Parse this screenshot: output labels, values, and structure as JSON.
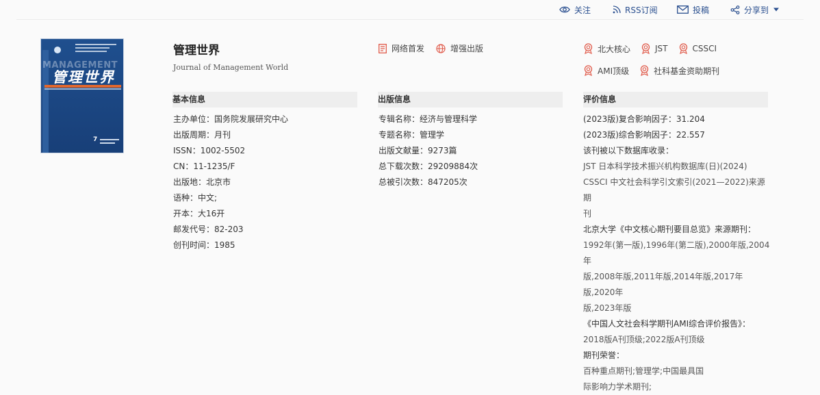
{
  "toolbar": {
    "follow": "关注",
    "rss": "RSS订阅",
    "submit": "投稿",
    "share": "分享到"
  },
  "cover": {
    "title": "管理世界",
    "english_band": "MANAGEMENT",
    "issue": "7"
  },
  "journal": {
    "title": "管理世界",
    "english_title": "Journal of Management World"
  },
  "publish_modes": [
    "网络首发",
    "增强出版"
  ],
  "badges": {
    "row1": [
      "北大核心",
      "JST",
      "CSSCI"
    ],
    "row2": [
      "AMI顶级",
      "社科基金资助期刊"
    ]
  },
  "basic_info": {
    "heading": "基本信息",
    "rows": [
      "主办单位：国务院发展研究中心",
      "出版周期：月刊",
      "ISSN：1002-5502",
      "CN：11-1235/F",
      "出版地：北京市",
      "语种：中文;",
      "开本：大16开",
      "邮发代号：82-203",
      "创刊时间：1985"
    ]
  },
  "publication_info": {
    "heading": "出版信息",
    "rows": [
      "专辑名称：经济与管理科学",
      "专题名称：管理学",
      "出版文献量：9273篇",
      "总下载次数：29209884次",
      "总被引次数：847205次"
    ]
  },
  "evaluation_info": {
    "heading": "评价信息",
    "lines": [
      "(2023版)复合影响因子：31.204",
      "(2023版)综合影响因子：22.557",
      "该刊被以下数据库收录：",
      "JST 日本科学技术振兴机构数据库(日)(2024)",
      "CSSCI 中文社会科学引文索引(2021—2022)来源期",
      "刊",
      "北京大学《中文核心期刊要目总览》来源期刊：",
      "1992年(第一版),1996年(第二版),2000年版,2004年",
      "版,2008年版,2011年版,2014年版,2017年版,2020年",
      "版,2023年版",
      "《中国人文社会科学期刊AMI综合评价报告》：",
      "2018版A刊顶级;2022版A刊顶级",
      "期刊荣誉：",
      "百种重点期刊;管理学;中国最具国",
      "际影响力学术期刊;"
    ]
  },
  "colors": {
    "link_blue": "#2a4f8f",
    "badge_red": "#e05a4a",
    "cover_blue": "#1f4f8e",
    "cover_orange": "#e4682d"
  }
}
